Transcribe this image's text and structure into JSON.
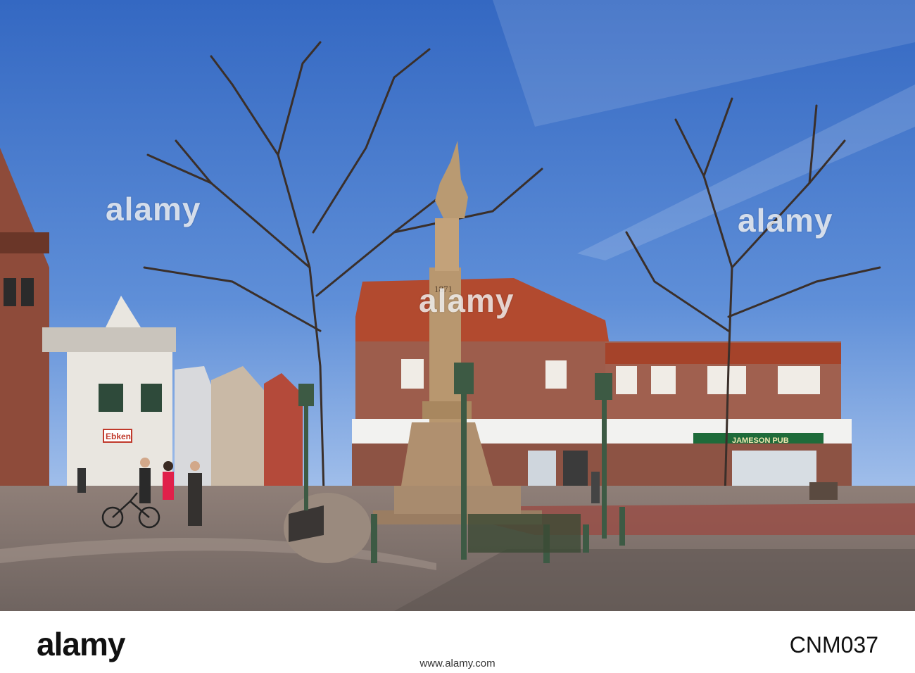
{
  "image": {
    "description_colors": {
      "sky_top": "#3a6fc4",
      "sky_bottom": "#8fb4ea",
      "brick": "#9a5a4a",
      "roof": "#b5452c",
      "pavement": "#8a7a72",
      "lamp_green": "#3d5a44"
    }
  },
  "signs": {
    "ebken": "Ebken",
    "pub": "JAMESON PUB",
    "monument_year": "1871"
  },
  "watermark": {
    "text": "alamy"
  },
  "footer": {
    "logo": "alamy",
    "image_code": "CNM037",
    "url": "www.alamy.com"
  }
}
